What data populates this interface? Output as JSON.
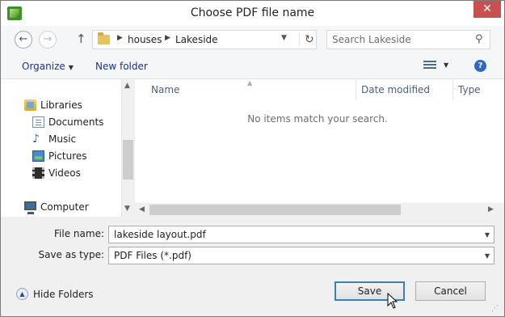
{
  "window": {
    "title": "Choose PDF file name",
    "close_glyph": "✕",
    "app_icon": "chief-architect-app-icon"
  },
  "nav": {
    "back_glyph": "←",
    "forward_glyph": "→",
    "up_glyph": "↑"
  },
  "address": {
    "breadcrumbs": [
      "houses",
      "Lakeside"
    ],
    "refresh_glyph": "↻"
  },
  "search": {
    "placeholder": "Search Lakeside"
  },
  "toolbar": {
    "organize_label": "Organize",
    "new_folder_label": "New folder",
    "help_glyph": "?"
  },
  "sidebar": {
    "items": [
      {
        "label": "Libraries",
        "icon": "libraries-icon"
      },
      {
        "label": "Documents",
        "icon": "documents-icon"
      },
      {
        "label": "Music",
        "icon": "music-icon"
      },
      {
        "label": "Pictures",
        "icon": "pictures-icon"
      },
      {
        "label": "Videos",
        "icon": "videos-icon"
      },
      {
        "label": "Computer",
        "icon": "computer-icon"
      }
    ]
  },
  "filelist": {
    "columns": [
      "Name",
      "Date modified",
      "Type"
    ],
    "empty_message": "No items match your search."
  },
  "form": {
    "filename_label": "File name:",
    "filename_value": "lakeside layout.pdf",
    "type_label": "Save as type:",
    "type_value": "PDF Files (*.pdf)"
  },
  "footer": {
    "hide_folders_label": "Hide Folders",
    "save_label": "Save",
    "cancel_label": "Cancel"
  },
  "colors": {
    "close_red": "#c75050",
    "link_blue": "#1e3287",
    "default_button_border": "#3c7fb1"
  }
}
